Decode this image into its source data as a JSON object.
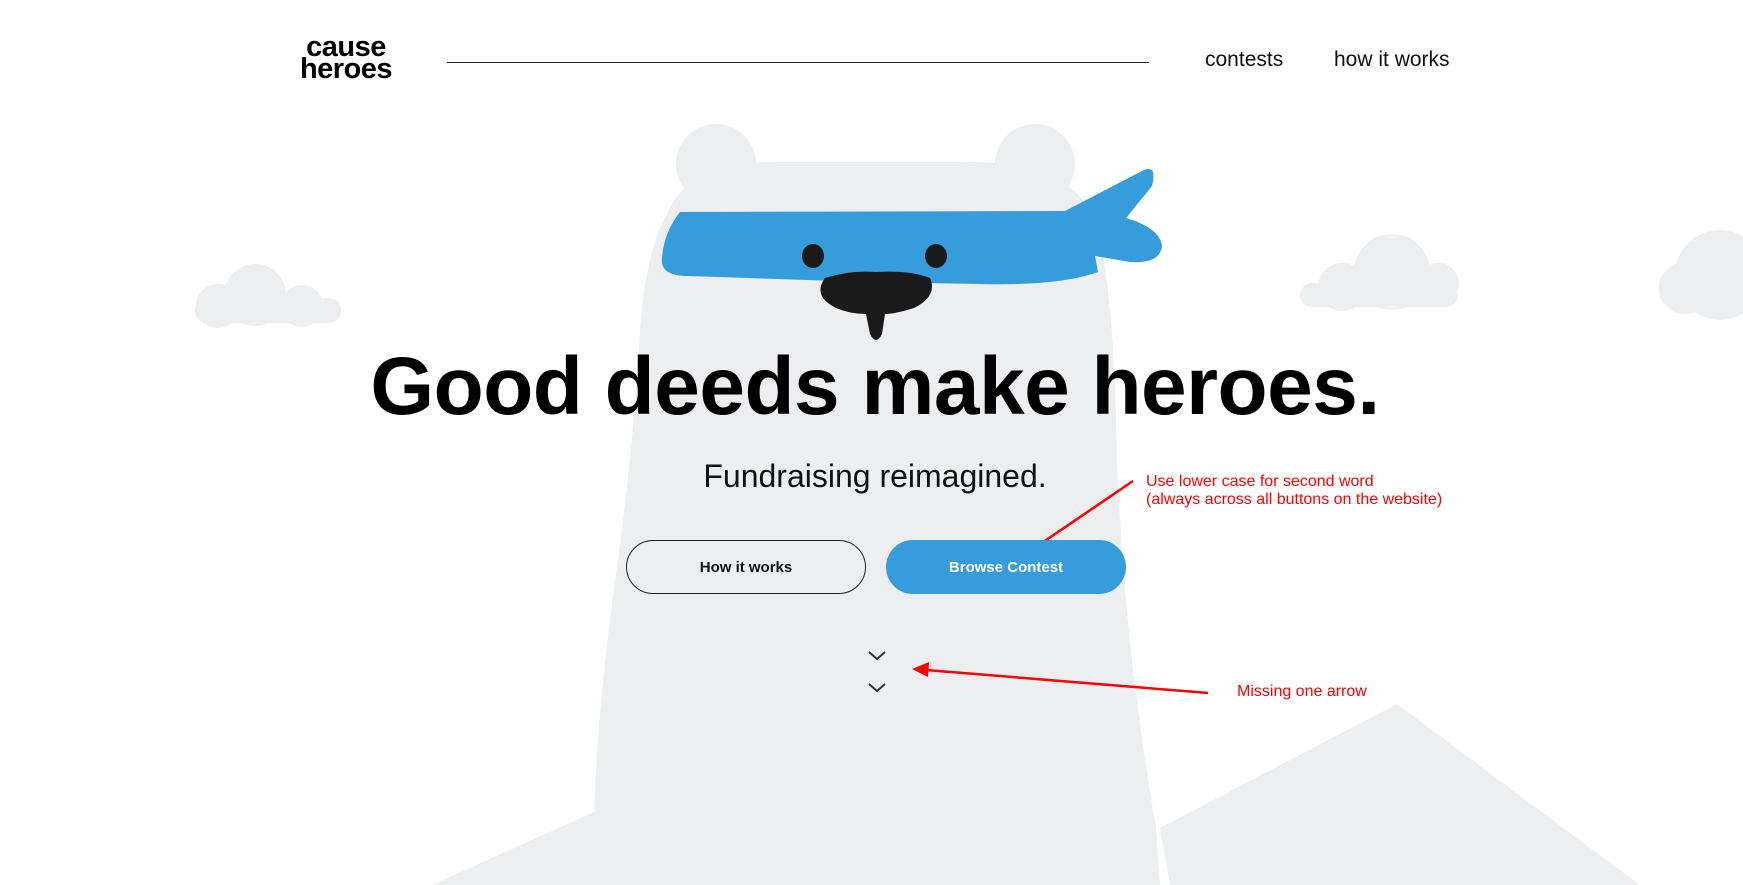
{
  "logo": {
    "line1": "cause",
    "line2": "heroes"
  },
  "nav": {
    "items": [
      {
        "label": "contests"
      },
      {
        "label": "how it works"
      }
    ]
  },
  "hero": {
    "headline": "Good deeds make heroes.",
    "subheadline": "Fundraising reimagined.",
    "buttons": {
      "secondary": "How it works",
      "primary": "Browse Contest"
    }
  },
  "scroll_indicator": {
    "icon": "chevron-down-icon",
    "count": 2
  },
  "annotations": [
    {
      "lines": [
        "Use lower case for second word",
        "(always across all buttons on the website)"
      ]
    },
    {
      "lines": [
        "Missing one arrow"
      ]
    }
  ],
  "colors": {
    "brand_blue": "#379cdc",
    "illustration_gray": "#eceeef",
    "text": "#000000",
    "annotation": "#ff0000",
    "nose": "#1a1a1a"
  }
}
